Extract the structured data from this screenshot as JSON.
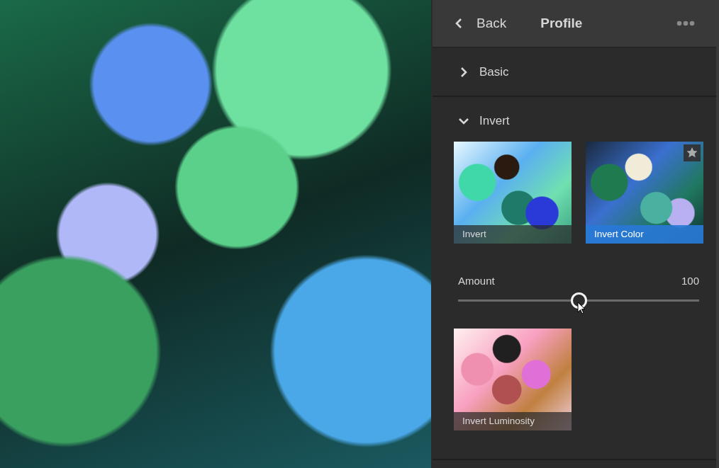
{
  "photo": {
    "kind": "photo"
  },
  "header": {
    "back_label": "Back",
    "title": "Profile"
  },
  "sections": [
    {
      "title": "Basic",
      "expanded": false
    },
    {
      "title": "Invert",
      "expanded": true,
      "items": [
        {
          "kind": "profile",
          "label": "Invert",
          "selected": false,
          "star": false
        },
        {
          "kind": "profile",
          "label": "Invert Color",
          "selected": true,
          "star": true
        },
        {
          "kind": "amount",
          "label": "Amount",
          "value": "100",
          "level": 0.5
        },
        {
          "kind": "profile",
          "label": "Invert Luminosity",
          "selected": false,
          "star": false
        }
      ]
    }
  ]
}
